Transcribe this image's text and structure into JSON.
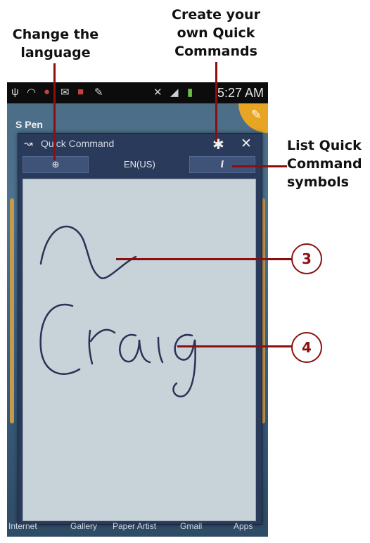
{
  "callouts": {
    "change_language": "Change the language",
    "create_commands": "Create your own Quick Commands",
    "list_symbols": "List Quick Command symbols",
    "step_3": "3",
    "step_4": "4"
  },
  "status_bar": {
    "time": "5:27 AM",
    "icons": [
      "usb-icon",
      "wifi-icon",
      "notification-icon",
      "mail-icon",
      "store-icon",
      "pen-icon",
      "mute-icon",
      "signal-icon",
      "battery-icon"
    ]
  },
  "screen": {
    "spen_label": "S Pen",
    "edit_tab_icon": "pencil-icon"
  },
  "quick_command": {
    "title": "Quick Command",
    "language_code": "EN(US)",
    "language_button_icon": "globe-icon",
    "info_button_icon": "info-icon",
    "settings_icon": "gear-icon",
    "close_icon": "close-icon",
    "handwriting_word": "Craig"
  },
  "dock": {
    "items": [
      "Internet",
      "Gallery",
      "Paper Artist",
      "Gmail",
      "Apps"
    ]
  },
  "colors": {
    "callout_accent": "#8a1010",
    "dialog_bg": "#2a3a5a",
    "pad_bg": "#c8d2d9",
    "ink": "#2a3356",
    "edit_tab": "#e6a623"
  }
}
